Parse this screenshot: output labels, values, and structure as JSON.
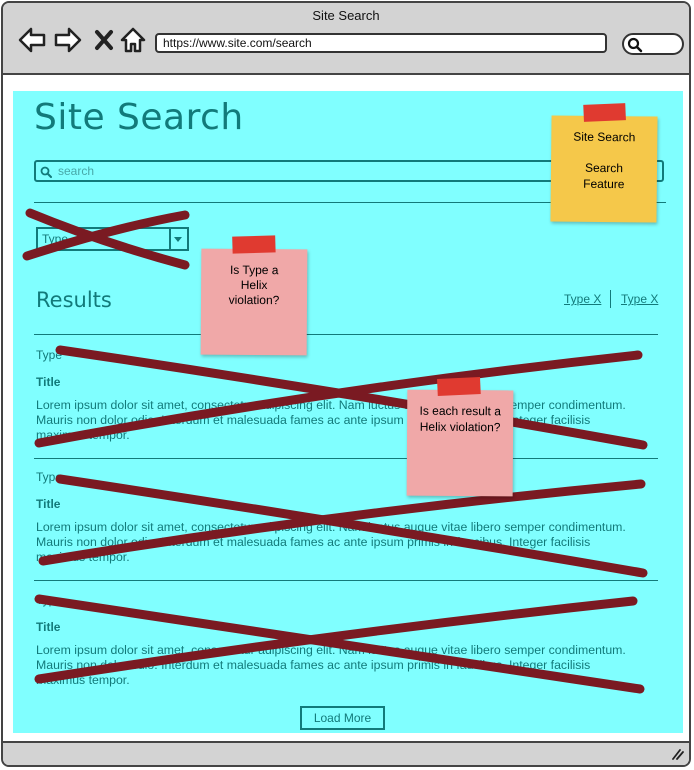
{
  "window": {
    "title": "Site Search"
  },
  "browser": {
    "url": "https://www.site.com/search"
  },
  "page": {
    "title": "Site Search",
    "search_placeholder": "search",
    "type_filter_label": "Type",
    "results_heading": "Results",
    "sort_links": [
      "Type X",
      "Type X"
    ],
    "results": [
      {
        "type": "Type",
        "title": "Title",
        "body": "Lorem ipsum dolor sit amet, consectetur adipiscing elit. Nam luctus augue vitae libero semper condimentum. Mauris non dolor odio. Interdum et malesuada fames ac ante ipsum primis in faucibus. Integer facilisis maximus tempor."
      },
      {
        "type": "Type",
        "title": "Title",
        "body": "Lorem ipsum dolor sit amet, consectetur adipiscing elit. Nam luctus augue vitae libero semper condimentum. Mauris non dolor odio. Interdum et malesuada fames ac ante ipsum primis in faucibus. Integer facilisis maximus tempor."
      },
      {
        "type": "Type",
        "title": "Title",
        "body": "Lorem ipsum dolor sit amet, consectetur adipiscing elit. Nam luctus augue vitae libero semper condimentum. Mauris non dolor odio. Interdum et malesuada fames ac ante ipsum primis in faucibus. Integer facilisis maximus tempor."
      }
    ],
    "load_more_label": "Load More"
  },
  "notes": {
    "feature": {
      "line1": "Site Search",
      "line2": "Search Feature"
    },
    "type_question": "Is Type a Helix violation?",
    "result_question": "Is each result a Helix violation?"
  },
  "colors": {
    "content_bg": "#80ffff",
    "text_teal": "#127a7a",
    "strike": "#7a1a22",
    "note_yellow": "#f5c84a",
    "note_pink": "#f0a8a8",
    "tape_red": "#e03a30",
    "chrome_gray": "#d3d3d3"
  },
  "icons": [
    "back-arrow-icon",
    "forward-arrow-icon",
    "close-icon",
    "home-icon",
    "search-icon",
    "resize-grip-icon",
    "chevron-down-icon"
  ]
}
